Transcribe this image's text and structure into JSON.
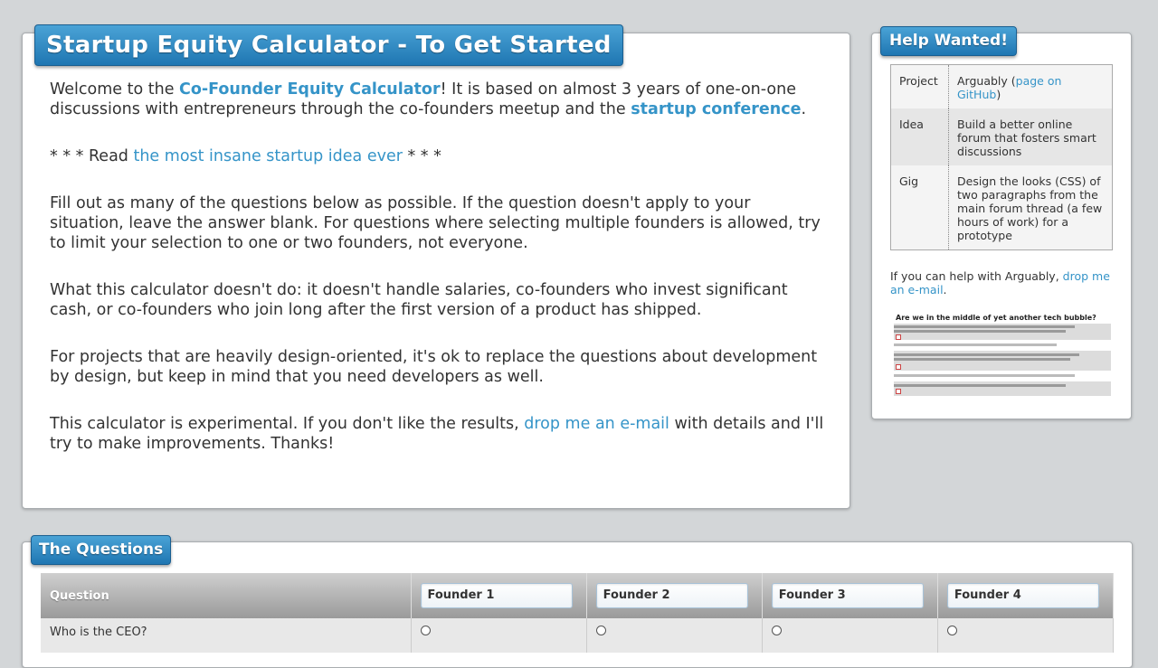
{
  "main": {
    "title": "Startup Equity Calculator - To Get Started",
    "p1": {
      "t1": "Welcome to the ",
      "link1": "Co-Founder Equity Calculator",
      "t2": "! It is based on almost 3 years of one-on-one discussions with entrepreneurs through the co-founders meetup and the ",
      "link2": "startup conference",
      "t3": "."
    },
    "p2": {
      "t1": "* * * Read ",
      "link": "the most insane startup idea ever",
      "t2": " * * *"
    },
    "p3": "Fill out as many of the questions below as possible. If the question doesn't apply to your situation, leave the answer blank. For questions where selecting multiple founders is allowed, try to limit your selection to one or two founders, not everyone.",
    "p4": "What this calculator doesn't do: it doesn't handle salaries, co-founders who invest significant cash, or co-founders who join long after the first version of a product has shipped.",
    "p5": "For projects that are heavily design-oriented, it's ok to replace the questions about development by design, but keep in mind that you need developers as well.",
    "p6": {
      "t1": "This calculator is experimental. If you don't like the results, ",
      "link": "drop me an e-mail",
      "t2": " with details and I'll try to make improvements. Thanks!"
    }
  },
  "side": {
    "title": "Help Wanted!",
    "table": {
      "project_label": "Project",
      "project_value": "Arguably (",
      "project_link": "page on GitHub",
      "project_close": ")",
      "idea_label": "Idea",
      "idea_value": "Build a better online forum that fosters smart discussions",
      "gig_label": "Gig",
      "gig_value": "Design the looks (CSS) of two paragraphs from the main forum thread (a few hours of work) for a prototype"
    },
    "help_text": "If you can help with Arguably, ",
    "help_link": "drop me an e-mail",
    "help_end": ".",
    "thumbnail_title": "Are we in the middle of yet another tech bubble?"
  },
  "questions": {
    "title": "The Questions",
    "question_header": "Question",
    "founders": [
      "Founder 1",
      "Founder 2",
      "Founder 3",
      "Founder 4"
    ],
    "first_row": "Who is the CEO?"
  },
  "colors": {
    "link": "#3594c8",
    "title_bg": "#1f76b2",
    "page_bg": "#d3d6d8"
  }
}
